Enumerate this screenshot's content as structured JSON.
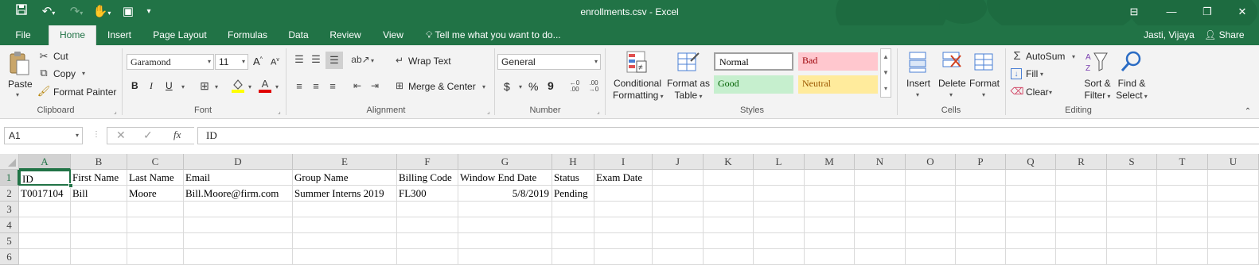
{
  "title": "enrollments.csv - Excel",
  "qat": {
    "save_icon": "save-icon",
    "undo_icon": "undo-icon",
    "redo_icon": "redo-icon",
    "touch_icon": "touch-mode-icon",
    "customize_icon": "customize-qat-icon"
  },
  "tabs": [
    "File",
    "Home",
    "Insert",
    "Page Layout",
    "Formulas",
    "Data",
    "Review",
    "View"
  ],
  "tell_me": "Tell me what you want to do...",
  "user": "Jasti, Vijaya",
  "share": "Share",
  "clipboard": {
    "paste": "Paste",
    "cut": "Cut",
    "copy": "Copy",
    "format_painter": "Format Painter",
    "label": "Clipboard"
  },
  "font": {
    "name": "Garamond",
    "size": "11",
    "bold": "B",
    "italic": "I",
    "underline": "U",
    "label": "Font"
  },
  "alignment": {
    "wrap_text": "Wrap Text",
    "merge_center": "Merge & Center",
    "label": "Alignment"
  },
  "number": {
    "format": "General",
    "currency": "$",
    "percent": "%",
    "comma": "9",
    "label": "Number"
  },
  "styles": {
    "conditional": [
      "Conditional",
      "Formatting"
    ],
    "format_as": [
      "Format as",
      "Table"
    ],
    "normal": "Normal",
    "bad": "Bad",
    "good": "Good",
    "neutral": "Neutral",
    "label": "Styles",
    "colors": {
      "bad_bg": "#ffc7ce",
      "bad_fg": "#9c0006",
      "good_bg": "#c6efce",
      "good_fg": "#006100",
      "neutral_bg": "#ffeb9c",
      "neutral_fg": "#9c5700"
    }
  },
  "cells_group": {
    "insert": "Insert",
    "delete": "Delete",
    "format": "Format",
    "label": "Cells"
  },
  "editing": {
    "autosum": "AutoSum",
    "fill": "Fill",
    "clear": "Clear",
    "sort": [
      "Sort &",
      "Filter"
    ],
    "find": [
      "Find &",
      "Select"
    ],
    "label": "Editing"
  },
  "formula_bar": {
    "name_box": "A1",
    "fx": "fx",
    "content": "ID"
  },
  "columns": [
    "A",
    "B",
    "C",
    "D",
    "E",
    "F",
    "G",
    "H",
    "I",
    "J",
    "K",
    "L",
    "M",
    "N",
    "O",
    "P",
    "Q",
    "R",
    "S",
    "T",
    "U"
  ],
  "rows": [
    "1",
    "2",
    "3",
    "4",
    "5",
    "6"
  ],
  "sheet": [
    [
      "ID",
      "First Name",
      "Last Name",
      "Email",
      "Group Name",
      "Billing Code",
      "Window End Date",
      "Status",
      "Exam Date"
    ],
    [
      "T0017104",
      "Bill",
      "Moore",
      "Bill.Moore@firm.com",
      "Summer Interns 2019",
      "FL300",
      "5/8/2019",
      "Pending",
      ""
    ]
  ],
  "accent": "#217346"
}
